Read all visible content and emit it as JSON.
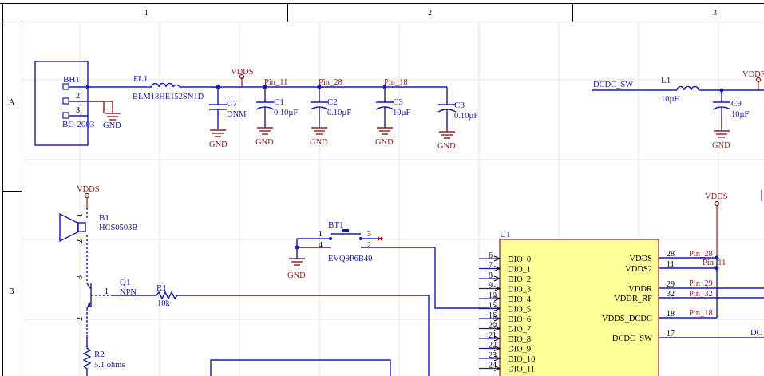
{
  "zones": {
    "col1": "1",
    "col2": "2",
    "col3": "3",
    "rowA": "A",
    "rowB": "B"
  },
  "bh1": {
    "ref": "BH1",
    "pin2": "2",
    "pin3": "3",
    "value": "BC-2003"
  },
  "fl1": {
    "ref": "FL1",
    "value": "BLM18HE152SN1D"
  },
  "c7": {
    "ref": "C7",
    "value": "DNM"
  },
  "c1": {
    "ref": "C1",
    "value": "0.10µF"
  },
  "c2": {
    "ref": "C2",
    "value": "0.10µF"
  },
  "c3": {
    "ref": "C3",
    "value": "10µF"
  },
  "c8": {
    "ref": "C8",
    "value": "0.10µF"
  },
  "c9": {
    "ref": "C9",
    "value": "10µF"
  },
  "l1": {
    "ref": "L1",
    "value": "10µH"
  },
  "nets": {
    "vdds": "VDDS",
    "vddr": "VDDR",
    "gnd": "GND",
    "pin11": "Pin_11",
    "pin28": "Pin_28",
    "pin18": "Pin_18",
    "dcdc_sw": "DCDC_SW",
    "dc_partial": "DC",
    "u_pin28": "Pin_28",
    "u_pin11": "Pin_11",
    "u_pin29": "Pin_29",
    "u_pin32": "Pin_32",
    "u_pin18": "Pin_18"
  },
  "b1": {
    "ref": "B1",
    "value": "HCS0503B",
    "pin1": "1",
    "pin2": "2"
  },
  "q1": {
    "ref": "Q1",
    "value": "NPN",
    "pin1": "1",
    "pin2": "2",
    "pin3": "3"
  },
  "r1": {
    "ref": "R1",
    "value": "10k"
  },
  "r2": {
    "ref": "R2",
    "value": "5.1 ohms"
  },
  "bt1": {
    "ref": "BT1",
    "value": "EVQ9P6B40",
    "pin1": "1",
    "pin2": "2",
    "pin3": "3",
    "pin4": "4"
  },
  "u1": {
    "ref": "U1",
    "left_pins": [
      {
        "num": "6",
        "name": "DIO_0"
      },
      {
        "num": "7",
        "name": "DIO_1"
      },
      {
        "num": "8",
        "name": "DIO_2"
      },
      {
        "num": "9",
        "name": "DIO_3"
      },
      {
        "num": "10",
        "name": "DIO_4"
      },
      {
        "num": "15",
        "name": "DIO_5"
      },
      {
        "num": "16",
        "name": "DIO_6"
      },
      {
        "num": "20",
        "name": "DIO_7"
      },
      {
        "num": "21",
        "name": "DIO_8"
      },
      {
        "num": "22",
        "name": "DIO_9"
      },
      {
        "num": "23",
        "name": "DIO_10"
      },
      {
        "num": "24",
        "name": "DIO_11"
      }
    ],
    "right_pins": [
      {
        "num": "28",
        "name": "VDDS"
      },
      {
        "num": "11",
        "name": "VDDS2"
      },
      {
        "num": "29",
        "name": "VDDR"
      },
      {
        "num": "32",
        "name": "VDDR_RF"
      },
      {
        "num": "18",
        "name": "VDDS_DCDC"
      },
      {
        "num": "17",
        "name": "DCDC_SW"
      }
    ]
  }
}
